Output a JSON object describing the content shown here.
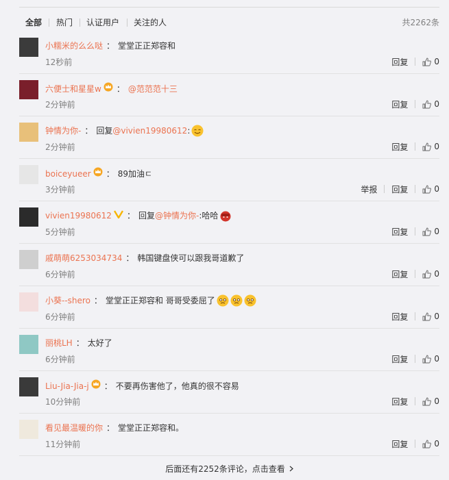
{
  "tabs": [
    "全部",
    "热门",
    "认证用户",
    "关注的人"
  ],
  "total": "共2262条",
  "actions": {
    "reply": "回复",
    "report": "举报"
  },
  "comments": [
    {
      "user": "小糯米的么么哒",
      "badge": "",
      "reply_prefix": "",
      "mention": "",
      "text": "堂堂正正郑容和",
      "time": "12秒前",
      "likes": "0",
      "report": false,
      "emojis": [],
      "avatar_color": "#3b3b3b"
    },
    {
      "user": "六便士和星星w",
      "badge": "crown-icon",
      "reply_prefix": "",
      "mention": "@范范范十三",
      "text": "",
      "time": "2分钟前",
      "likes": "0",
      "report": false,
      "emojis": [],
      "avatar_color": "#7a1f2b"
    },
    {
      "user": "钟情为你-",
      "badge": "",
      "reply_prefix": "回复",
      "mention": "@vivien19980612",
      "text": ":",
      "time": "2分钟前",
      "likes": "0",
      "report": false,
      "emojis": [
        "smile-emoji"
      ],
      "avatar_color": "#e8c07a"
    },
    {
      "user": "boiceyueer",
      "badge": "crown-icon",
      "reply_prefix": "",
      "mention": "",
      "text": "89加油ㄷ",
      "time": "3分钟前",
      "likes": "0",
      "report": true,
      "emojis": [],
      "avatar_color": "#e6e6e6"
    },
    {
      "user": "vivien19980612",
      "badge": "v-icon",
      "reply_prefix": "回复",
      "mention": "@钟情为你-",
      "text": ":哈哈",
      "time": "5分钟前",
      "likes": "0",
      "report": false,
      "emojis": [
        "face-emoji"
      ],
      "avatar_color": "#2b2b2b"
    },
    {
      "user": "戚萌萌6253034734",
      "badge": "",
      "reply_prefix": "",
      "mention": "",
      "text": "韩国键盘侠可以跟我哥道歉了",
      "time": "6分钟前",
      "likes": "0",
      "report": false,
      "emojis": [],
      "avatar_color": "#cfcfcf"
    },
    {
      "user": "小葵--shero",
      "badge": "",
      "reply_prefix": "",
      "mention": "",
      "text": "堂堂正正郑容和 哥哥受委屈了",
      "time": "6分钟前",
      "likes": "0",
      "report": false,
      "emojis": [
        "sad-emoji",
        "sad-emoji",
        "sad-emoji"
      ],
      "avatar_color": "#f3dede"
    },
    {
      "user": "丽桃LH",
      "badge": "",
      "reply_prefix": "",
      "mention": "",
      "text": "太好了",
      "time": "6分钟前",
      "likes": "0",
      "report": false,
      "emojis": [],
      "avatar_color": "#8fc8c4"
    },
    {
      "user": "Liu-Jia-Jia-j",
      "badge": "crown-icon",
      "reply_prefix": "",
      "mention": "",
      "text": "不要再伤害他了，他真的很不容易",
      "time": "10分钟前",
      "likes": "0",
      "report": false,
      "emojis": [],
      "avatar_color": "#3a3a3a"
    },
    {
      "user": "看见最温暖的你",
      "badge": "",
      "reply_prefix": "",
      "mention": "",
      "text": "堂堂正正郑容和。",
      "time": "11分钟前",
      "likes": "0",
      "report": false,
      "emojis": [],
      "avatar_color": "#efe9dd"
    }
  ],
  "more": "后面还有2252条评论，点击查看",
  "colors": {
    "accent": "#eb7350",
    "time": "#808080",
    "bg": "#f2f2f5"
  }
}
